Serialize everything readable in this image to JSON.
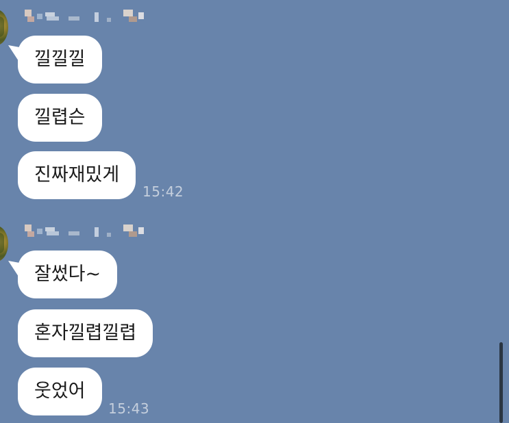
{
  "messages": [
    {
      "text": "낄낄낄"
    },
    {
      "text": "낄렵슨"
    },
    {
      "text": "진짜재밌게"
    },
    {
      "text": "잘썼다~"
    },
    {
      "text": "혼자낄렵낄렵"
    },
    {
      "text": "웃었어"
    }
  ],
  "timestamps": {
    "group1": "15:42",
    "group2": "15:43"
  },
  "colors": {
    "background": "#6884ab",
    "bubble": "#ffffff",
    "timestamp": "#c5cfdd"
  }
}
